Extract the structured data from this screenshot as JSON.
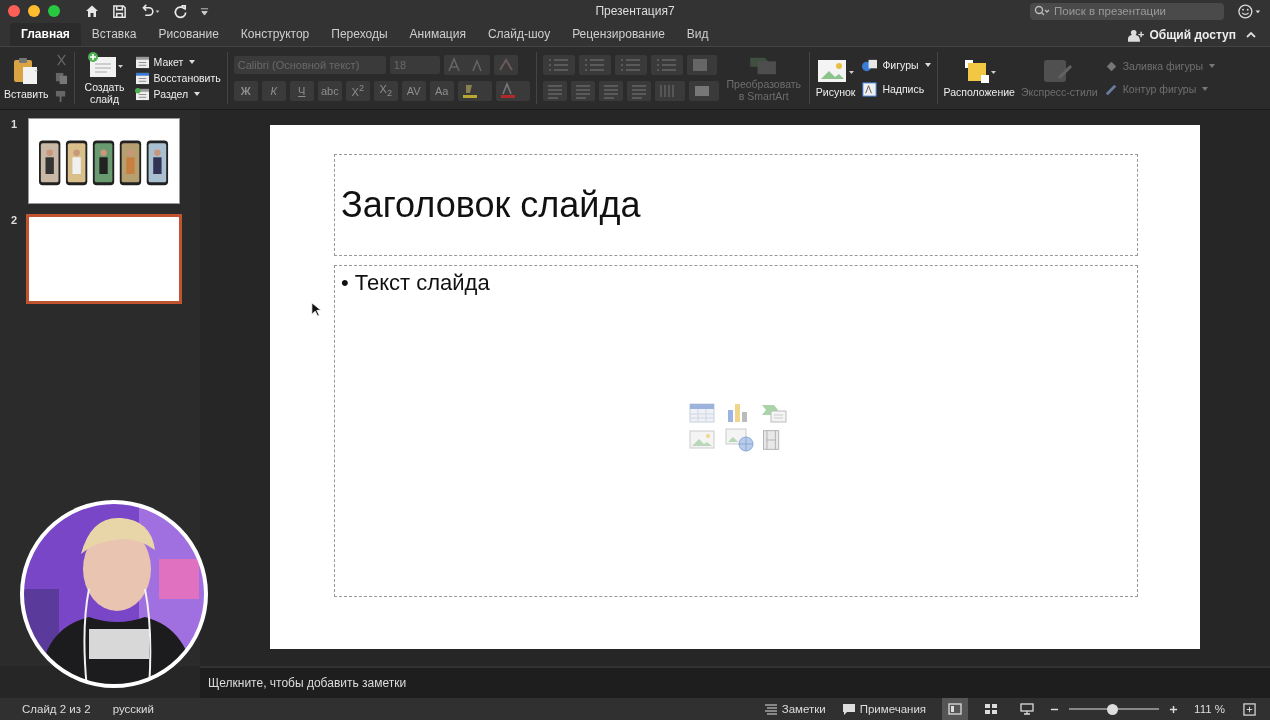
{
  "window": {
    "title": "Презентация7",
    "search_placeholder": "Поиск в презентации"
  },
  "tabs": [
    {
      "label": "Главная",
      "selected": true
    },
    {
      "label": "Вставка",
      "selected": false
    },
    {
      "label": "Рисование",
      "selected": false
    },
    {
      "label": "Конструктор",
      "selected": false
    },
    {
      "label": "Переходы",
      "selected": false
    },
    {
      "label": "Анимация",
      "selected": false
    },
    {
      "label": "Слайд-шоу",
      "selected": false
    },
    {
      "label": "Рецензирование",
      "selected": false
    },
    {
      "label": "Вид",
      "selected": false
    }
  ],
  "share": {
    "label": "Общий доступ"
  },
  "ribbon": {
    "paste": {
      "label": "Вставить",
      "disabled": false
    },
    "new_slide": {
      "label": "Создать слайд",
      "disabled": false
    },
    "slide_commands": [
      {
        "label": "Макет",
        "dropdown": true,
        "disabled": false
      },
      {
        "label": "Восстановить",
        "dropdown": false,
        "disabled": false
      },
      {
        "label": "Раздел",
        "dropdown": true,
        "disabled": false
      }
    ],
    "font": {
      "name": "Calibri (Основной текст)",
      "size": "18",
      "disabled": true
    },
    "format_buttons": [
      {
        "label": "Ж",
        "disabled": true
      },
      {
        "label": "К",
        "disabled": true
      },
      {
        "label": "Ч",
        "disabled": true
      },
      {
        "label": "abc",
        "disabled": true
      },
      {
        "label": "X$^{2}$",
        "disabled": true
      },
      {
        "label": "X$_{2}$",
        "disabled": true
      },
      {
        "label": "AV",
        "disabled": true
      },
      {
        "label": "Aa",
        "disabled": true
      }
    ],
    "smartart": {
      "label": "Преобразовать в SmartArt",
      "disabled": true
    },
    "picture": {
      "label": "Рисунок",
      "disabled": false
    },
    "insert_commands": [
      {
        "label": "Фигуры",
        "dropdown": true,
        "disabled": false
      },
      {
        "label": "Надпись",
        "dropdown": false,
        "disabled": false
      }
    ],
    "arrange": {
      "label": "Расположение",
      "disabled": false
    },
    "quick_styles": {
      "label": "Экспресс-стили",
      "disabled": true
    },
    "shape_commands": [
      {
        "label": "Заливка фигуры",
        "disabled": true
      },
      {
        "label": "Контур фигуры",
        "disabled": true
      }
    ]
  },
  "thumbnails": [
    {
      "number": "1",
      "selected": false,
      "kind": "picture"
    },
    {
      "number": "2",
      "selected": true,
      "kind": "blank"
    }
  ],
  "slide": {
    "title": "Заголовок слайда",
    "bullet": "•",
    "body": "Текст слайда"
  },
  "notes": {
    "placeholder": "Щелкните, чтобы добавить заметки"
  },
  "status_bar": {
    "slide": "Слайд 2 из 2",
    "language": "русский",
    "notes": "Заметки",
    "comments": "Примечания",
    "views": [
      {
        "selected": true
      },
      {
        "selected": false
      },
      {
        "selected": false
      }
    ],
    "zoom_slider": {
      "level": 0.48
    },
    "zoom": "111 %"
  }
}
